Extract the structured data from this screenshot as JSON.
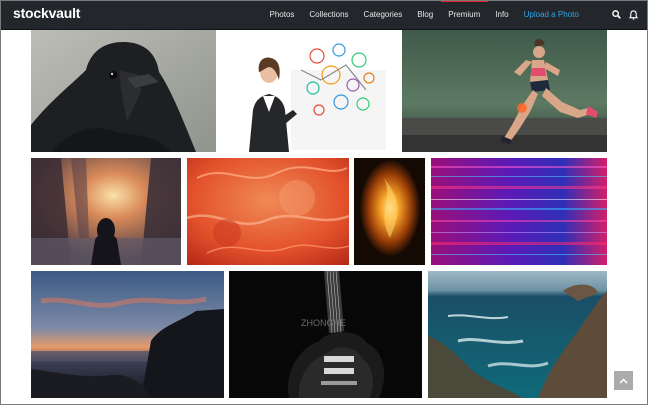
{
  "brand": {
    "logo_text": "stockvault"
  },
  "nav": {
    "items": [
      {
        "label": "Photos"
      },
      {
        "label": "Collections"
      },
      {
        "label": "Categories"
      },
      {
        "label": "Blog"
      },
      {
        "label": "Premium"
      },
      {
        "label": "Info"
      },
      {
        "label": "Upload a Photo"
      }
    ],
    "icons": [
      "search-icon",
      "bell-icon"
    ]
  },
  "gallery": {
    "rows": [
      {
        "photos": [
          "raven-closeup",
          "businesswoman-with-doodle-icons",
          "woman-running-on-road"
        ]
      },
      {
        "photos": [
          "city-street-at-sunset-with-silhouette",
          "orange-abstract-ink-texture",
          "flame-on-black",
          "purple-pink-glitch-stripes"
        ]
      },
      {
        "photos": [
          "coast-at-dusk-with-rocks",
          "electric-guitar-black-and-white",
          "rocky-cliffs-and-sea-waves"
        ]
      }
    ],
    "watermark_text": "ZHONGHE"
  },
  "colors": {
    "navbar": "#23272c",
    "accent_red": "#e0262f",
    "upload_blue": "#30a6e6"
  },
  "ui": {
    "back_to_top_icon": "chevron-up-icon"
  }
}
